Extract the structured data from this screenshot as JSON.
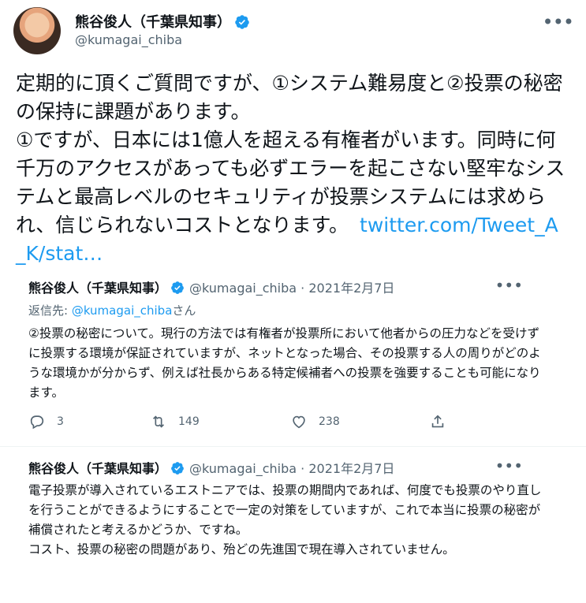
{
  "tweet": {
    "author_name": "熊谷俊人（千葉県知事）",
    "author_handle": "@kumagai_chiba",
    "text": "定期的に頂くご質問ですが、①システム難易度と②投票の秘密の保持に課題があります。\n①ですが、日本には1億人を超える有権者がいます。同時に何千万のアクセスがあっても必ずエラーを起こさない堅牢なシステムと最高レベルのセキュリティが投票システムには求められ、信じられないコストとなります。",
    "link": "twitter.com/Tweet_A_K/stat…",
    "more_icon": "more-icon",
    "verified_icon": "verified-badge-icon"
  },
  "reply1": {
    "author_name": "熊谷俊人（千葉県知事）",
    "author_handle": "@kumagai_chiba",
    "date": "· 2021年2月7日",
    "reply_to_label": "返信先: ",
    "reply_to_handle": "@kumagai_chiba",
    "reply_to_suffix": "さん",
    "text": "②投票の秘密について。現行の方法では有権者が投票所において他者からの圧力などを受けずに投票する環境が保証されていますが、ネットとなった場合、その投票する人の周りがどのような環境かが分からず、例えば社長からある特定候補者への投票を強要することも可能になります。",
    "replies": "3",
    "retweets": "149",
    "likes": "238"
  },
  "reply2": {
    "author_name": "熊谷俊人（千葉県知事）",
    "author_handle": "@kumagai_chiba",
    "date": "· 2021年2月7日",
    "text": "電子投票が導入されているエストニアでは、投票の期間内であれば、何度でも投票のやり直しを行うことができるようにすることで一定の対策をしていますが、これで本当に投票の秘密が補償されたと考えるかどうか、ですね。\nコスト、投票の秘密の問題があり、殆どの先進国で現在導入されていません。"
  },
  "colors": {
    "accent": "#1d9bf0",
    "muted": "#536471",
    "text": "#0f1419"
  }
}
